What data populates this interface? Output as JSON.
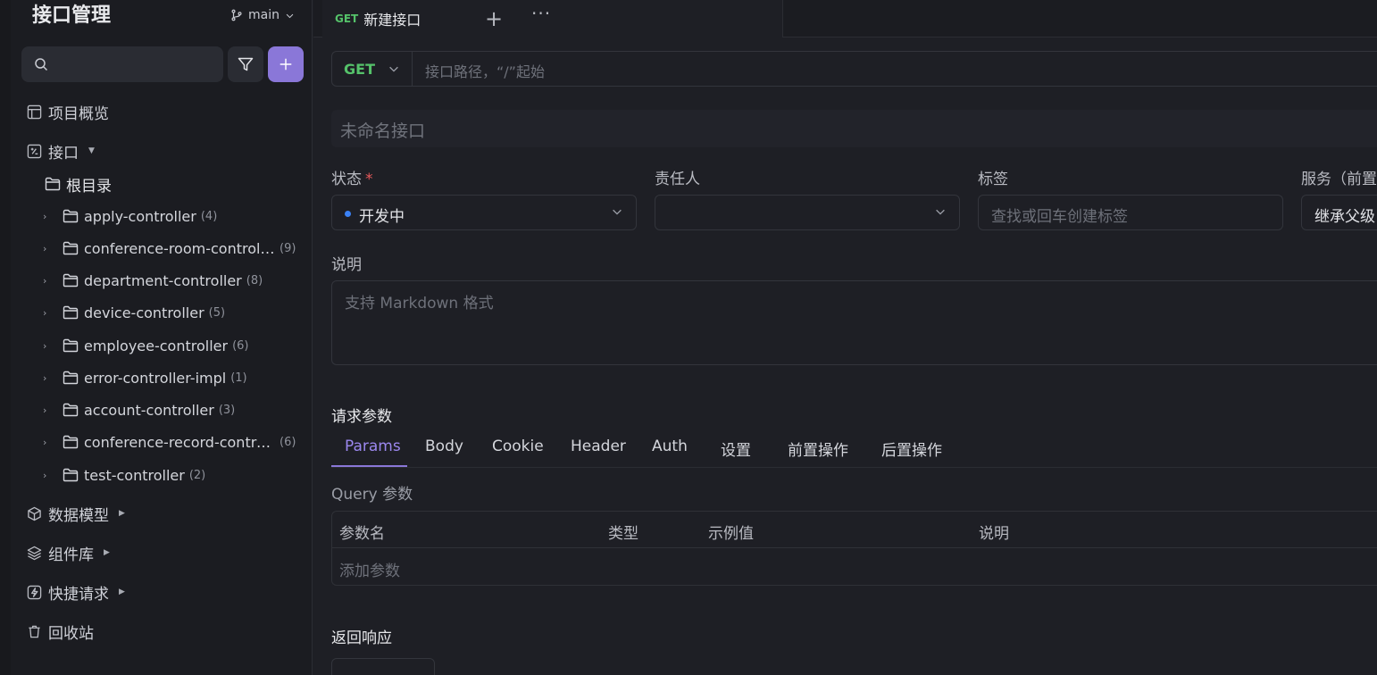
{
  "sidebar": {
    "title": "接口管理",
    "branch": "main",
    "nav": {
      "overview": "项目概览",
      "api": "接口",
      "root": "根目录",
      "models": "数据模型",
      "components": "组件库",
      "quick": "快捷请求",
      "trash": "回收站"
    },
    "folders": [
      {
        "name": "apply-controller",
        "count": "(4)"
      },
      {
        "name": "conference-room-controller",
        "count": "(9)"
      },
      {
        "name": "department-controller",
        "count": "(8)"
      },
      {
        "name": "device-controller",
        "count": "(5)"
      },
      {
        "name": "employee-controller",
        "count": "(6)"
      },
      {
        "name": "error-controller-impl",
        "count": "(1)"
      },
      {
        "name": "account-controller",
        "count": "(3)"
      },
      {
        "name": "conference-record-controller",
        "count": "(6)"
      },
      {
        "name": "test-controller",
        "count": "(2)"
      }
    ]
  },
  "tabbar": {
    "active_method": "GET",
    "active_name": "新建接口",
    "plus": "+",
    "more": "···"
  },
  "request": {
    "method": "GET",
    "url_placeholder": "接口路径，“/”起始",
    "name_placeholder": "未命名接口"
  },
  "fields": {
    "status_label": "状态",
    "required_mark": "*",
    "status_value": "开发中",
    "owner_label": "责任人",
    "tags_label": "标签",
    "tags_placeholder": "查找或回车创建标签",
    "service_label": "服务（前置",
    "service_value": "继承父级",
    "desc_label": "说明",
    "desc_placeholder": "支持 Markdown 格式"
  },
  "params": {
    "section_title": "请求参数",
    "tabs": [
      "Params",
      "Body",
      "Cookie",
      "Header",
      "Auth",
      "设置",
      "前置操作",
      "后置操作"
    ],
    "query_label": "Query 参数",
    "columns": [
      "参数名",
      "类型",
      "示例值",
      "说明"
    ],
    "add_param": "添加参数"
  },
  "response": {
    "section_title": "返回响应"
  },
  "colors": {
    "accent": "#8a77d8",
    "get_method": "#55c26a",
    "status_dot": "#3b82f6",
    "required": "#e8585a"
  }
}
